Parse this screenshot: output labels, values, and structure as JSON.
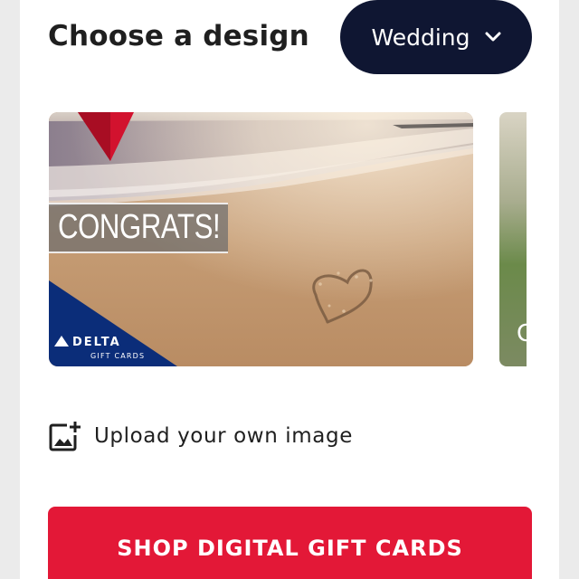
{
  "header": {
    "title": "Choose a design",
    "category": {
      "selected": "Wedding",
      "icon": "chevron-down-icon"
    }
  },
  "carousel": {
    "cards": [
      {
        "headline": "CONGRATS!",
        "brand": "DELTA",
        "brand_sub": "GIFT CARDS",
        "scene": "beach with heart drawn in sand"
      }
    ],
    "peek_glyph": "C"
  },
  "upload": {
    "label": "Upload your own image",
    "icon": "add-photo-icon"
  },
  "cta": {
    "label": "SHOP DIGITAL GIFT CARDS"
  },
  "colors": {
    "navy": "#0f1632",
    "delta_red": "#e31837",
    "delta_blue": "#0b2d79"
  }
}
